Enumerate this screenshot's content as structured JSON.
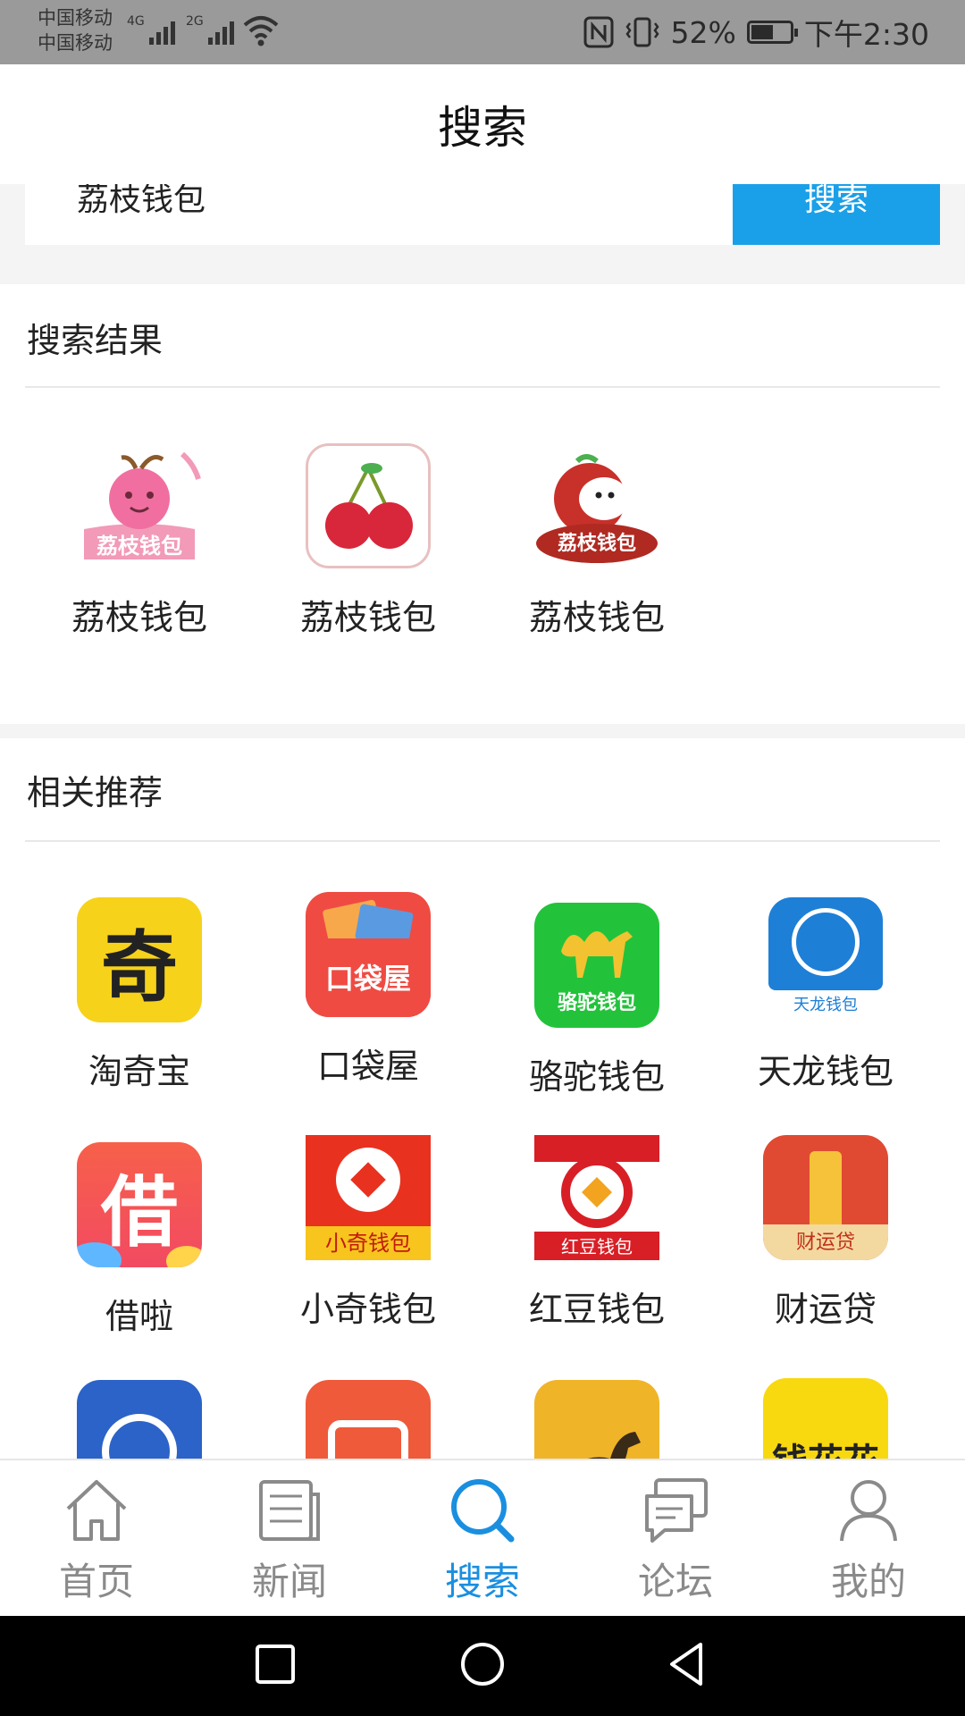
{
  "status_bar": {
    "carrier_1": "中国移动",
    "carrier_2": "中国移动",
    "net_1": "4G",
    "net_2": "2G",
    "battery": "52%",
    "time": "下午2:30"
  },
  "header": {
    "title": "搜索"
  },
  "search": {
    "query": "荔枝钱包",
    "button_label": "搜索"
  },
  "results": {
    "title": "搜索结果",
    "apps": [
      {
        "name": "荔枝钱包",
        "icon": "lychee-pink-icon"
      },
      {
        "name": "荔枝钱包",
        "icon": "cherry-icon"
      },
      {
        "name": "荔枝钱包",
        "icon": "lychee-red-icon"
      }
    ],
    "icon_texts": [
      "荔枝钱包",
      "荔枝钱包"
    ]
  },
  "recommend": {
    "title": "相关推荐",
    "apps": [
      {
        "name": "淘奇宝",
        "icon_text": "奇",
        "color": "#f7d21b"
      },
      {
        "name": "口袋屋",
        "icon_text": "口袋屋",
        "color": "#ef4b43"
      },
      {
        "name": "骆驼钱包",
        "icon_text": "骆驼钱包",
        "color": "#22c33a"
      },
      {
        "name": "天龙钱包",
        "icon_text": "天龙钱包",
        "color": "#1e7fd6"
      },
      {
        "name": "借啦",
        "icon_text": "借",
        "color": "#f25a4a"
      },
      {
        "name": "小奇钱包",
        "icon_text": "小奇钱包",
        "color": "#e8321f"
      },
      {
        "name": "红豆钱包",
        "icon_text": "红豆钱包",
        "color": "#d81f26"
      },
      {
        "name": "财运贷",
        "icon_text": "财运贷",
        "color": "#e04a33"
      },
      {
        "name": "",
        "icon_text": "",
        "color": "#2c63c8"
      },
      {
        "name": "",
        "icon_text": "",
        "color": "#ef5a3a"
      },
      {
        "name": "",
        "icon_text": "",
        "color": "#f0b429"
      },
      {
        "name": "",
        "icon_text": "钱花花",
        "color": "#f8d90f"
      }
    ]
  },
  "bottom_nav": [
    {
      "label": "首页",
      "icon": "home-icon"
    },
    {
      "label": "新闻",
      "icon": "news-icon"
    },
    {
      "label": "搜索",
      "icon": "search-icon",
      "active": true
    },
    {
      "label": "论坛",
      "icon": "forum-icon"
    },
    {
      "label": "我的",
      "icon": "user-icon"
    }
  ],
  "colors": {
    "accent": "#1a8fe0",
    "search_button": "#1aa0e8"
  }
}
